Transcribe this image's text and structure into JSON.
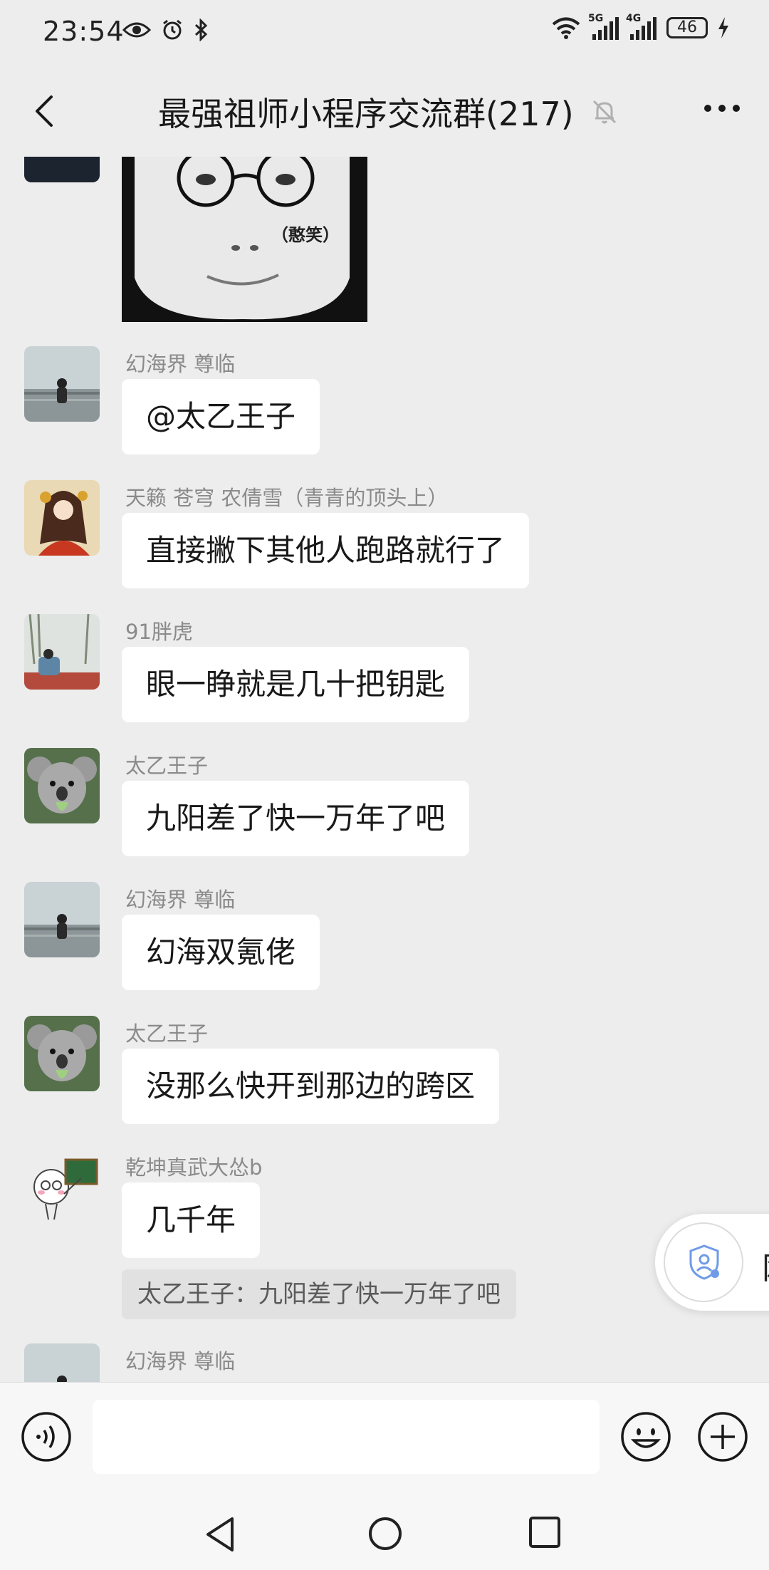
{
  "status_bar": {
    "time": "23:54",
    "battery": "46",
    "network_1": "5G",
    "network_2": "4G",
    "icons": [
      "eye-icon",
      "alarm-icon",
      "bluetooth-icon",
      "wifi-icon",
      "signal-icon",
      "charging-icon"
    ]
  },
  "nav": {
    "title": "最强祖师小程序交流群(217)",
    "icons": [
      "back-icon",
      "mute-bell-icon",
      "more-icon"
    ]
  },
  "meme": {
    "caption": "（憨笑）"
  },
  "messages": [
    {
      "sender": "幻海界 尊临",
      "text": "@太乙王子"
    },
    {
      "sender": "天籁 苍穹 农倩雪（青青的顶头上）",
      "text": "直接撇下其他人跑路就行了"
    },
    {
      "sender": "91胖虎",
      "text": "眼一睁就是几十把钥匙"
    },
    {
      "sender": "太乙王子",
      "text": "九阳差了快一万年了吧"
    },
    {
      "sender": "幻海界 尊临",
      "text": "幻海双氪佬"
    },
    {
      "sender": "太乙王子",
      "text": "没那么快开到那边的跨区"
    },
    {
      "sender": "乾坤真武大怂b",
      "text": "几千年",
      "quote": "太乙王子：九阳差了快一万年了吧"
    },
    {
      "sender": "幻海界 尊临",
      "text": ""
    }
  ],
  "floating_widget": {
    "peek_text": "网",
    "icon": "shield-user-icon"
  },
  "input_bar": {
    "value": "",
    "icons": [
      "voice-icon",
      "emoji-icon",
      "plus-icon"
    ]
  },
  "system_nav": {
    "icons": [
      "sys-back-icon",
      "sys-home-icon",
      "sys-recent-icon"
    ]
  },
  "colors": {
    "background": "#ededed",
    "bubble": "#ffffff",
    "sender_text": "#8a8a8a",
    "quote_bg": "#e1e1e1",
    "accent_blue": "#6f9be8"
  }
}
